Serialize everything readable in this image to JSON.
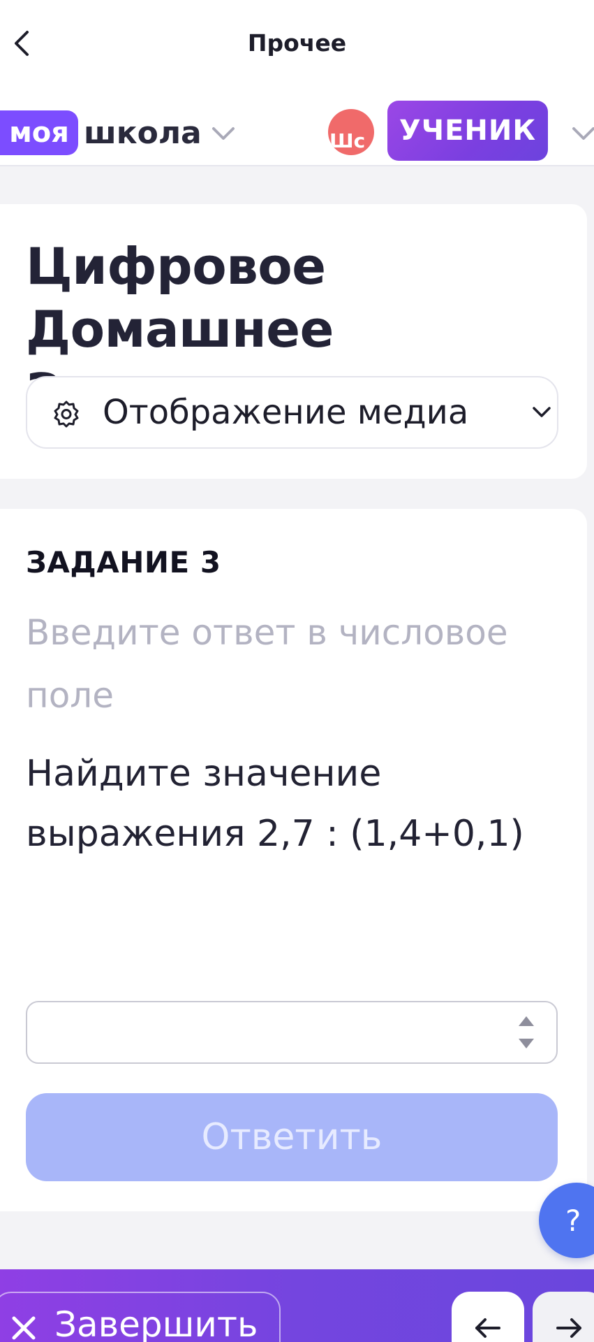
{
  "topnav": {
    "title": "Прочее",
    "back_icon": "chevron-left-icon"
  },
  "school": {
    "logo_badge": "моя",
    "logo_word": "школа",
    "avatar_initials": "Шс",
    "role": "УЧЕНИК"
  },
  "header": {
    "title": "Цифровое Домашнее Задание",
    "media_select_label": "Отображение медиа",
    "media_icon": "gear-icon"
  },
  "task": {
    "number_label": "ЗАДАНИЕ 3",
    "hint": "Введите ответ в числовое поле",
    "question": "Найдите значение выражения 2,7 : (1,4+0,1)",
    "input_value": "",
    "submit_label": "Ответить"
  },
  "help": {
    "label": "?"
  },
  "bottom": {
    "finish_label": "Завершить",
    "prev_icon": "arrow-left-icon",
    "next_icon": "arrow-right-icon"
  },
  "colors": {
    "accent": "#7c4dff",
    "role_gradient_start": "#9b47e6",
    "submit_disabled": "#a8b6f9",
    "help": "#4f74f0",
    "avatar": "#f06a6a"
  }
}
